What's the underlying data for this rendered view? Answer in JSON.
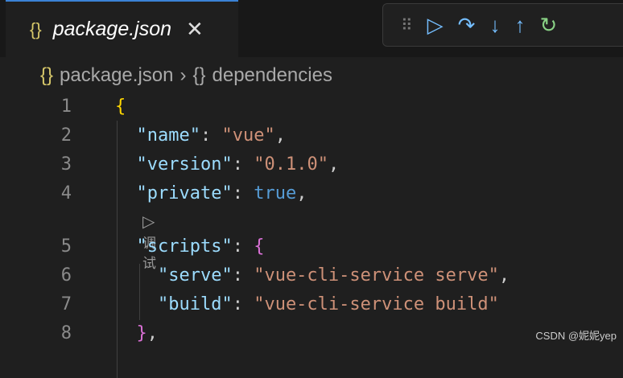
{
  "tab": {
    "icon": "{}",
    "label": "package.json",
    "close": "✕"
  },
  "debug_toolbar": {
    "grip": "⠿",
    "continue": "▷",
    "step_over": "↷",
    "step_into": "↓",
    "step_out": "↑",
    "restart": "↻"
  },
  "breadcrumb": {
    "file_icon": "{}",
    "file": "package.json",
    "sep": "›",
    "node_icon": "{}",
    "node": "dependencies"
  },
  "codelens": {
    "icon": "▷",
    "label": "调试"
  },
  "lines": [
    {
      "n": "1"
    },
    {
      "n": "2"
    },
    {
      "n": "3"
    },
    {
      "n": "4"
    },
    {
      "n": "5"
    },
    {
      "n": "6"
    },
    {
      "n": "7"
    },
    {
      "n": "8"
    }
  ],
  "code": {
    "l1": "{",
    "name_k": "\"name\"",
    "name_v": "\"vue\"",
    "ver_k": "\"version\"",
    "ver_v": "\"0.1.0\"",
    "priv_k": "\"private\"",
    "priv_v": "true",
    "scr_k": "\"scripts\"",
    "scr_open": "{",
    "serve_k": "\"serve\"",
    "serve_v": "\"vue-cli-service serve\"",
    "build_k": "\"build\"",
    "build_v": "\"vue-cli-service build\"",
    "close": "}"
  },
  "watermark": "CSDN @妮妮yep"
}
